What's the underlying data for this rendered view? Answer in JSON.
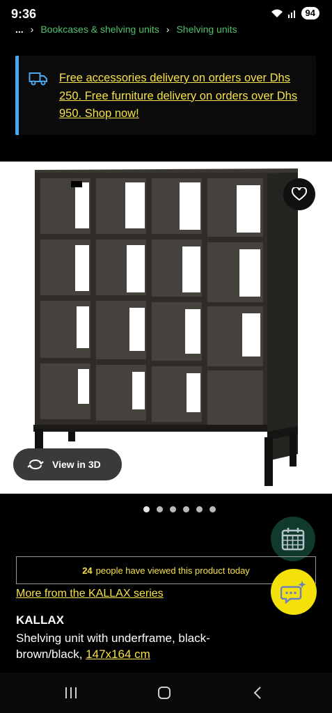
{
  "status_bar": {
    "time": "9:36",
    "battery": "94"
  },
  "breadcrumb": {
    "ellipsis": "...",
    "items": [
      "Bookcases & shelving units",
      "Shelving units"
    ]
  },
  "promo": {
    "icon": "delivery-truck-icon",
    "text": "Free accessories delivery on orders over Dhs 250. Free furniture delivery on orders over Dhs 950. Shop now!"
  },
  "image": {
    "view3d_label": "View in 3D",
    "carousel_count": 6,
    "active_index": 0
  },
  "viewed": {
    "count": "24",
    "text": "people have viewed this product today"
  },
  "series_link": "More from the KALLAX series",
  "product": {
    "name": "KALLAX",
    "description": "Shelving unit with underframe, black-brown/black, ",
    "size": "147x164 cm"
  },
  "colors": {
    "link_yellow": "#f7e14a",
    "breadcrumb_green": "#4fc36a",
    "promo_accent": "#4aa8f0",
    "chat_fab": "#f5e10a",
    "calendar_fab": "#0f3a2c"
  }
}
